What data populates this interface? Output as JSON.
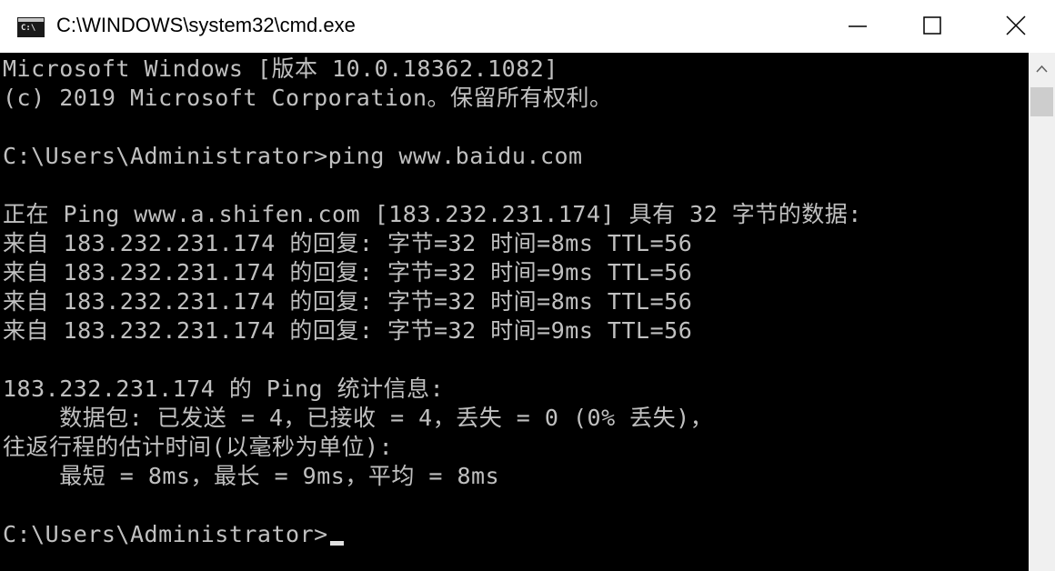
{
  "window": {
    "title": "C:\\WINDOWS\\system32\\cmd.exe",
    "icon_glyph": "C:\\",
    "controls": {
      "minimize_icon": "minimize-icon",
      "maximize_icon": "maximize-icon",
      "close_icon": "close-icon"
    }
  },
  "console": {
    "background": "#000000",
    "foreground": "#c0c0c0",
    "lines": [
      "Microsoft Windows [版本 10.0.18362.1082]",
      "(c) 2019 Microsoft Corporation。保留所有权利。",
      "",
      "C:\\Users\\Administrator>ping www.baidu.com",
      "",
      "正在 Ping www.a.shifen.com [183.232.231.174] 具有 32 字节的数据:",
      "来自 183.232.231.174 的回复: 字节=32 时间=8ms TTL=56",
      "来自 183.232.231.174 的回复: 字节=32 时间=9ms TTL=56",
      "来自 183.232.231.174 的回复: 字节=32 时间=8ms TTL=56",
      "来自 183.232.231.174 的回复: 字节=32 时间=9ms TTL=56",
      "",
      "183.232.231.174 的 Ping 统计信息:",
      "    数据包: 已发送 = 4，已接收 = 4，丢失 = 0 (0% 丢失)，",
      "往返行程的估计时间(以毫秒为单位):",
      "    最短 = 8ms，最长 = 9ms，平均 = 8ms",
      ""
    ],
    "prompt": "C:\\Users\\Administrator>"
  },
  "scrollbar": {
    "up_icon": "scroll-up-arrow-icon"
  }
}
